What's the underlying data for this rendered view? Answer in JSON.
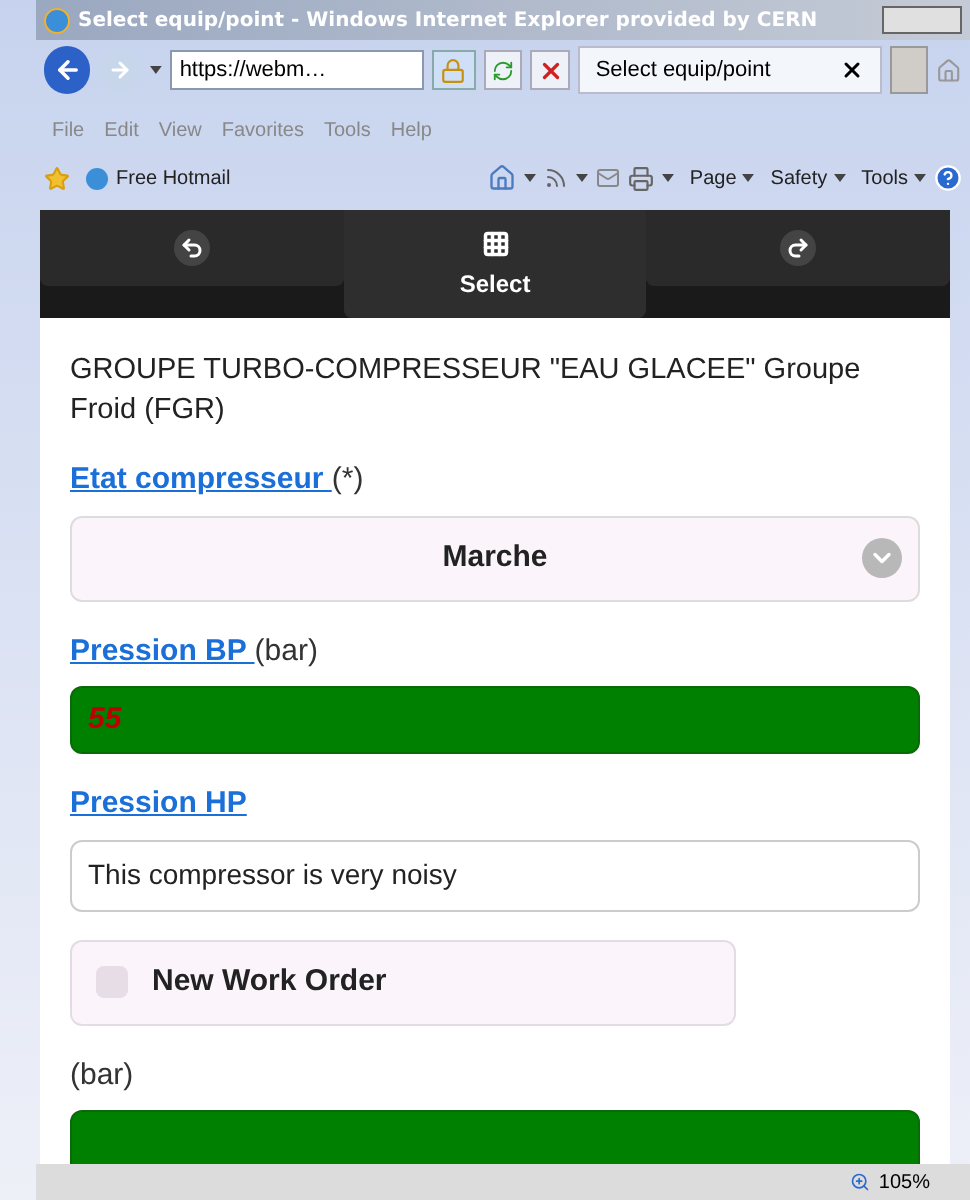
{
  "window": {
    "title": "Select equip/point - Windows Internet Explorer provided by CERN"
  },
  "address_bar": {
    "value": "https://webm…"
  },
  "tab": {
    "title": "Select equip/point"
  },
  "menu": [
    "File",
    "Edit",
    "View",
    "Favorites",
    "Tools",
    "Help"
  ],
  "favorites": [
    {
      "label": "Free Hotmail"
    }
  ],
  "command_bar": [
    "Page",
    "Safety",
    "Tools"
  ],
  "nav": [
    {
      "kind": "back",
      "selected": false
    },
    {
      "kind": "select",
      "label": "Select",
      "selected": true
    },
    {
      "kind": "forward",
      "selected": false
    }
  ],
  "page_title": "GROUPE TURBO-COMPRESSEUR \"EAU GLACEE\" Groupe Froid (FGR)",
  "fields": [
    {
      "kind": "select",
      "label": "Etat compresseur ",
      "suffix": "(*)",
      "value": "Marche"
    },
    {
      "kind": "number",
      "label": "Pression BP ",
      "suffix": "(bar)",
      "value": "55",
      "color": "#008000"
    },
    {
      "kind": "text",
      "label": "Pression HP",
      "value": "This compressor is very noisy"
    },
    {
      "kind": "checkbox",
      "label": "New Work Order",
      "checked": false
    },
    {
      "kind": "number",
      "suffix": "(bar)",
      "color": "#008000"
    }
  ],
  "status_bar": {
    "zoom": "105%"
  }
}
